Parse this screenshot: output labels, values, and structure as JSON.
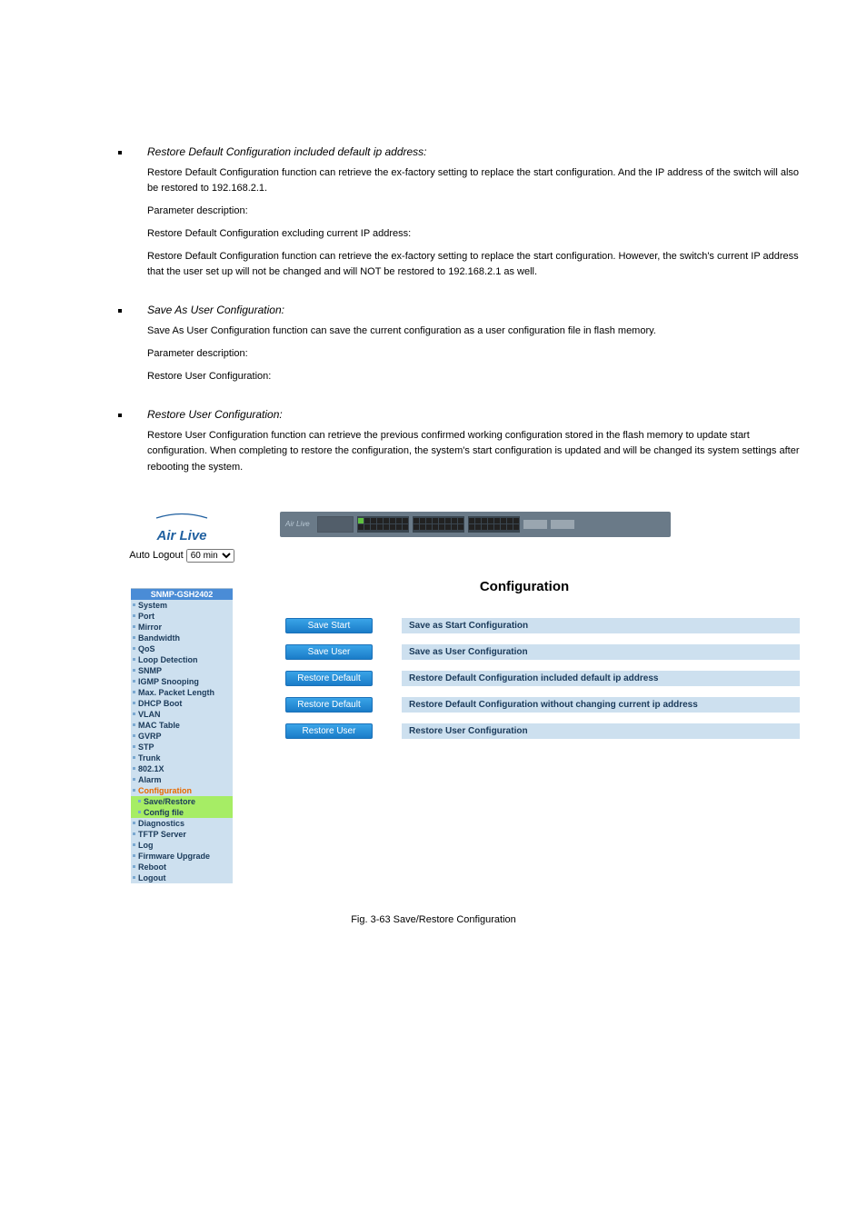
{
  "doc": {
    "section1": {
      "heading": "Restore Default Configuration included default ip address:",
      "p1": "Restore Default Configuration function can retrieve the ex-factory setting to replace the start configuration. And the IP address of the switch will also be restored to 192.168.2.1.",
      "p2_label": "Parameter description:",
      "p2": "Restore Default Configuration excluding current IP address:",
      "p3": "Restore Default Configuration function can retrieve the ex-factory setting to replace the start configuration. However, the switch's current IP address that the user set up will not be changed and will NOT be restored to 192.168.2.1 as well."
    },
    "section2": {
      "heading": "Save As User Configuration:",
      "p1": "Save As User Configuration function can save the current configuration as a user configuration file in flash memory.",
      "p2_label": "Parameter description:",
      "p2": "Restore User Configuration:"
    },
    "section3": {
      "heading": "Restore User Configuration:",
      "p1": "Restore User Configuration function can retrieve the previous confirmed working configuration stored in the flash memory to update start configuration. When completing to restore the configuration, the system's start configuration is updated and will be changed its system settings after rebooting the system."
    }
  },
  "app": {
    "brand": "Air Live",
    "auto_logout_label": "Auto Logout",
    "auto_logout_value": "60 min",
    "nav_header": "SNMP-GSH2402",
    "nav": [
      {
        "label": "System",
        "interactable": true
      },
      {
        "label": "Port",
        "interactable": true
      },
      {
        "label": "Mirror",
        "interactable": true
      },
      {
        "label": "Bandwidth",
        "interactable": true
      },
      {
        "label": "QoS",
        "interactable": true
      },
      {
        "label": "Loop Detection",
        "interactable": true
      },
      {
        "label": "SNMP",
        "interactable": true
      },
      {
        "label": "IGMP Snooping",
        "interactable": true
      },
      {
        "label": "Max. Packet Length",
        "interactable": true
      },
      {
        "label": "DHCP Boot",
        "interactable": true
      },
      {
        "label": "VLAN",
        "interactable": true
      },
      {
        "label": "MAC Table",
        "interactable": true
      },
      {
        "label": "GVRP",
        "interactable": true
      },
      {
        "label": "STP",
        "interactable": true
      },
      {
        "label": "Trunk",
        "interactable": true
      },
      {
        "label": "802.1X",
        "interactable": true
      },
      {
        "label": "Alarm",
        "interactable": true
      },
      {
        "label": "Configuration",
        "current": true
      },
      {
        "label": "Save/Restore",
        "level": 2,
        "hl": true
      },
      {
        "label": "Config file",
        "level": 2,
        "hl": true
      },
      {
        "label": "Diagnostics",
        "interactable": true
      },
      {
        "label": "TFTP Server",
        "interactable": true
      },
      {
        "label": "Log",
        "interactable": true
      },
      {
        "label": "Firmware Upgrade",
        "interactable": true
      },
      {
        "label": "Reboot",
        "interactable": true
      },
      {
        "label": "Logout",
        "interactable": true
      }
    ],
    "cfg_title": "Configuration",
    "rows": [
      {
        "btn": "Save Start",
        "desc": "Save as Start Configuration"
      },
      {
        "btn": "Save User",
        "desc": "Save as User Configuration"
      },
      {
        "btn": "Restore Default",
        "desc": "Restore Default Configuration included default ip address"
      },
      {
        "btn": "Restore Default",
        "desc": "Restore Default Configuration without changing current ip address"
      },
      {
        "btn": "Restore User",
        "desc": "Restore User Configuration"
      }
    ]
  },
  "fig_caption": "Fig. 3-63 Save/Restore Configuration"
}
